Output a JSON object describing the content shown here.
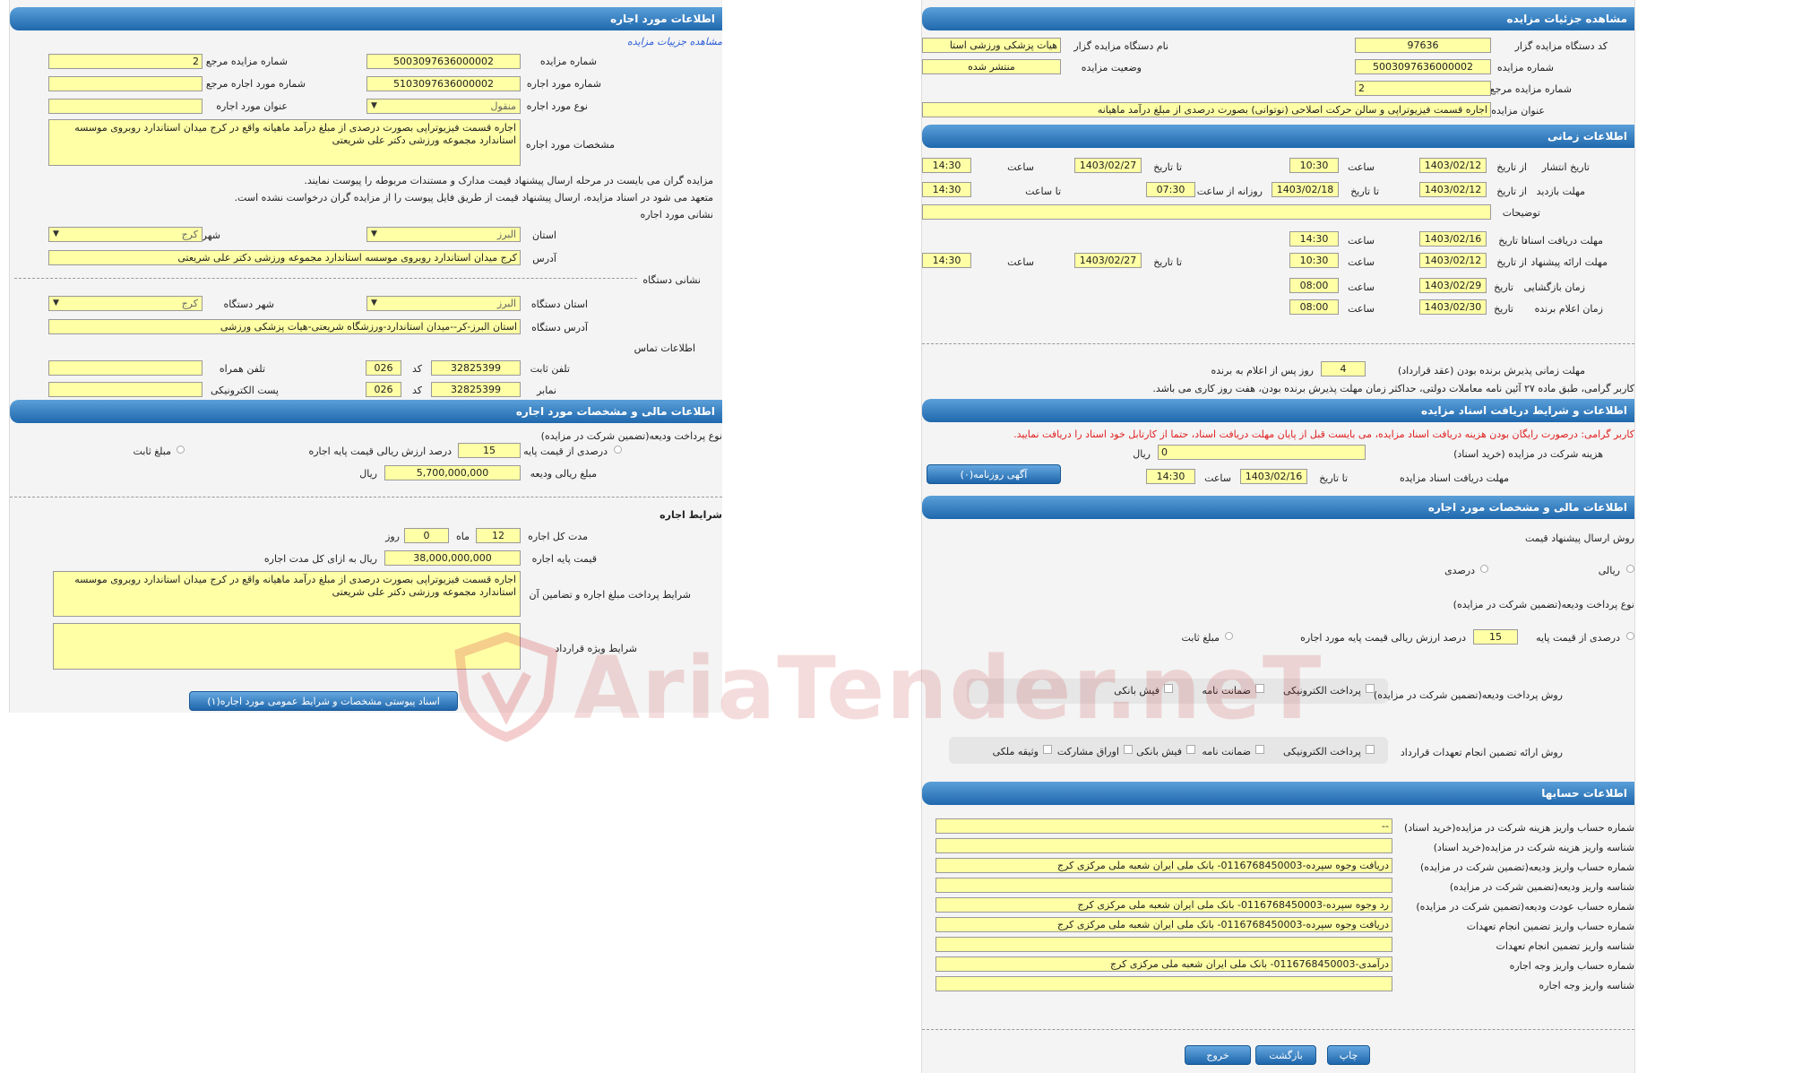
{
  "left": {
    "lease_info_header": "اطلاعات مورد اجاره",
    "view_link": "مشاهده جزییات مزایده",
    "auction_no_label": "شماره مزایده",
    "auction_no": "5003097636000002",
    "ref_auction_no_label": "شماره مزایده مرجع",
    "ref_auction_no": "2",
    "lease_no_label": "شماره مورد اجاره",
    "lease_no": "5103097636000002",
    "ref_lease_no_label": "شماره مورد اجاره مرجع",
    "ref_lease_no": "",
    "lease_type_label": "نوع مورد اجاره",
    "lease_type": "منقول",
    "lease_title_label": "عنوان مورد اجاره",
    "lease_title": "",
    "specs_label": "مشخصات مورد اجاره",
    "specs": "اجاره قسمت فیزیوتراپی بصورت درصدی از مبلغ درآمد ماهیانه واقع در کرج میدان استاندارد روبروی موسسه استاندارد مجموعه ورزشی دکتر علی شریعتی",
    "note1": "مزایده گران می بایست در مرحله ارسال پیشنهاد قیمت مدارک و مستندات مربوطه را پیوست نمایند.",
    "note2": "متعهد می شود در اسناد مزایده، ارسال پیشنهاد قیمت از طریق فایل پیوست را از مزایده گران درخواست نشده است.",
    "lease_address_title": "نشانی مورد اجاره",
    "province_label": "استان",
    "province": "البرز",
    "city_label": "شهر",
    "city": "کرج",
    "address_label": "آدرس",
    "address": "کرج میدان استاندارد روبروی موسسه استاندارد مجموعه ورزشی دکتر علی شریعتی",
    "device_address_title": "نشانی دستگاه",
    "device_province_label": "استان دستگاه",
    "device_province": "البرز",
    "device_city_label": "شهر دستگاه",
    "device_city": "کرج",
    "device_address_label": "آدرس دستگاه",
    "device_address": "استان البرز-کر--میدان استاندارد-ورزشگاه شریعتی-هیات پزشکی ورزشی",
    "contact_title": "اطلاعات تماس",
    "phone_label": "تلفن ثابت",
    "phone": "32825399",
    "code_label": "کد",
    "phone_code": "026",
    "mobile_label": "تلفن همراه",
    "mobile": "",
    "fax_label": "نمابر",
    "fax": "32825399",
    "fax_code": "026",
    "email_label": "پست الکترونیکی",
    "email": "",
    "financial_header": "اطلاعات مالی و مشخصات مورد اجاره",
    "deposit_method_label": "نوع پرداخت ودیعه(تضمین شرکت در مزایده)",
    "percent_label": "درصدی از قیمت پایه",
    "percent": "15",
    "percent_suffix": "درصد ارزش ریالی قیمت پایه اجاره",
    "fixed_label": "مبلغ ثابت",
    "deposit_amount_label": "مبلغ ریالی ودیعه",
    "deposit_amount": "5,700,000,000",
    "rial": "ریال",
    "lease_terms_title": "شرایط اجاره",
    "duration_label": "مدت کل اجاره",
    "months": "12",
    "month_label": "ماه",
    "days": "0",
    "day_label": "روز",
    "base_price_label": "قیمت پایه اجاره",
    "base_price": "38,000,000,000",
    "base_price_suffix": "ریال به ازای کل مدت اجاره",
    "payment_terms_label": "شرایط پرداخت مبلغ اجاره و تضامین آن",
    "payment_terms": "اجاره قسمت فیزیوتراپی بصورت درصدی از مبلغ درآمد ماهیانه واقع در کرج میدان استاندارد روبروی موسسه استاندارد مجموعه ورزشی دکتر علی شریعتی",
    "special_terms_label": "شرایط ویژه قرارداد",
    "special_terms": "",
    "attach_button": "اسناد پیوستی مشخصات و شرایط عمومی مورد اجاره(۱)"
  },
  "right": {
    "details_header": "مشاهده جزئیات مزایده",
    "org_code_label": "کد دستگاه مزایده گزار",
    "org_code": "97636",
    "org_name_label": "نام دستگاه مزایده گزار",
    "org_name": "هیات پزشکی ورزشی استا",
    "auction_no_label": "شماره مزایده",
    "auction_no": "5003097636000002",
    "status_label": "وضعیت مزایده",
    "status": "منتشر شده",
    "ref_no_label": "شماره مزایده مرجع",
    "ref_no": "2",
    "title_label": "عنوان مزایده",
    "title": "اجاره قسمت فیزیوتراپی و سالن حرکت اصلاحی (نوتوانی) بصورت درصدی از مبلغ درآمد ماهیانه",
    "time_header": "اطلاعات زمانی",
    "publish_label": "تاریخ انتشار",
    "from_date_label": "از تاریخ",
    "to_date_label": "تا تاریخ",
    "time_label": "ساعت",
    "publish_from": "1403/02/12",
    "publish_from_time": "10:30",
    "publish_to": "1403/02/27",
    "publish_to_time": "14:30",
    "visit_label": "مهلت بازدید",
    "visit_from": "1403/02/12",
    "visit_to": "1403/02/18",
    "daily_from_label": "روزانه از ساعت",
    "daily_from": "07:30",
    "to_time_label": "تا ساعت",
    "daily_to": "14:30",
    "desc_label": "توضیحات",
    "desc": "",
    "doc_deadline_label": "مهلت دریافت اسناد",
    "doc_deadline": "1403/02/16",
    "doc_deadline_time": "14:30",
    "offer_label": "مهلت ارائه پیشنهاد",
    "offer_from": "1403/02/12",
    "offer_from_time": "10:30",
    "offer_to": "1403/02/27",
    "offer_to_time": "14:30",
    "opening_label": "زمان بازگشایی",
    "date_label": "تاریخ",
    "opening_date": "1403/02/29",
    "opening_time": "08:00",
    "winner_label": "زمان اعلام برنده",
    "winner_date": "1403/02/30",
    "winner_time": "08:00",
    "acceptance_label": "مهلت زمانی پذیرش برنده بودن (عقد قرارداد)",
    "acceptance_days": "4",
    "acceptance_suffix": "روز پس از اعلام به برنده",
    "acceptance_note": "کاربر گرامی، طبق ماده ۲۷ آئین نامه معاملات دولتی، حداکثر زمان مهلت پذیرش برنده بودن، هفت روز کاری می باشد.",
    "docs_header": "اطلاعات و شرایط دریافت اسناد مزایده",
    "docs_warning": "کاربر گرامی: درصورت رایگان بودن هزینه دریافت اسناد مزایده، می بایست قبل از پایان مهلت دریافت اسناد، حتما از کارتابل خود اسناد را دریافت نمایید.",
    "doc_fee_label": "هزینه شرکت در مزایده (خرید اسناد)",
    "doc_fee": "0",
    "rial": "ریال",
    "doc_period_label": "مهلت دریافت اسناد مزایده",
    "doc_period_date": "1403/02/16",
    "doc_period_time": "14:30",
    "newspaper_button": "آگهی روزنامه(۰)",
    "financial_header": "اطلاعات مالی و مشخصات مورد اجاره",
    "bid_method_label": "روش ارسال پیشنهاد قیمت",
    "rial_option": "ریالی",
    "percent_option": "درصدی",
    "deposit_type_label": "نوع پرداخت ودیعه(تضمین شرکت در مزایده)",
    "percent_base_label": "درصدی از قیمت پایه",
    "percent": "15",
    "percent_suffix": "درصد ارزش ریالی قیمت پایه مورد اجاره",
    "fixed_label": "مبلغ ثابت",
    "deposit_method_label": "روش پرداخت ودیعه(تضمین شرکت در مزایده)",
    "epay": "پرداخت الکترونیکی",
    "guarantee": "ضمانت نامه",
    "receipt": "فیش بانکی",
    "commit_label": "روش ارائه تضمین انجام تعهدات قرارداد",
    "bonds": "اوراق مشارکت",
    "property": "وثیقه ملکی",
    "accounts_header": "اطلاعات حسابها",
    "acc1_label": "شماره حساب واریز هزینه شرکت در مزایده(خرید اسناد)",
    "acc1": "--",
    "acc2_label": "شناسه واریز هزینه شرکت در مزایده(خرید اسناد)",
    "acc2": "",
    "acc3_label": "شماره حساب واریز ودیعه(تضمین شرکت در مزایده)",
    "acc3": "دریافت وجوه سپرده-0116768450003- بانک ملی ایران شعبه ملی مرکزی کرج",
    "acc4_label": "شناسه واریز ودیعه(تضمین شرکت در مزایده)",
    "acc4": "",
    "acc5_label": "شماره حساب عودت ودیعه(تضمین شرکت در مزایده)",
    "acc5": "رد وجوه سپرده-0116768450003- بانک ملی ایران شعبه ملی مرکزی کرج",
    "acc6_label": "شماره حساب واریز تضمین انجام تعهدات",
    "acc6": "دریافت وجوه سپرده-0116768450003- بانک ملی ایران شعبه ملی مرکزی کرج",
    "acc7_label": "شناسه واریز تضمین انجام تعهدات",
    "acc7": "",
    "acc8_label": "شماره حساب واریز وجه اجاره",
    "acc8": "درآمدی-0116768450003- بانک ملی ایران شعبه ملی مرکزی کرج",
    "acc9_label": "شناسه واریز وجه اجاره",
    "acc9": "",
    "print_button": "چاپ",
    "back_button": "بازگشت",
    "exit_button": "خروج"
  },
  "watermark": "AriaTender.neT"
}
